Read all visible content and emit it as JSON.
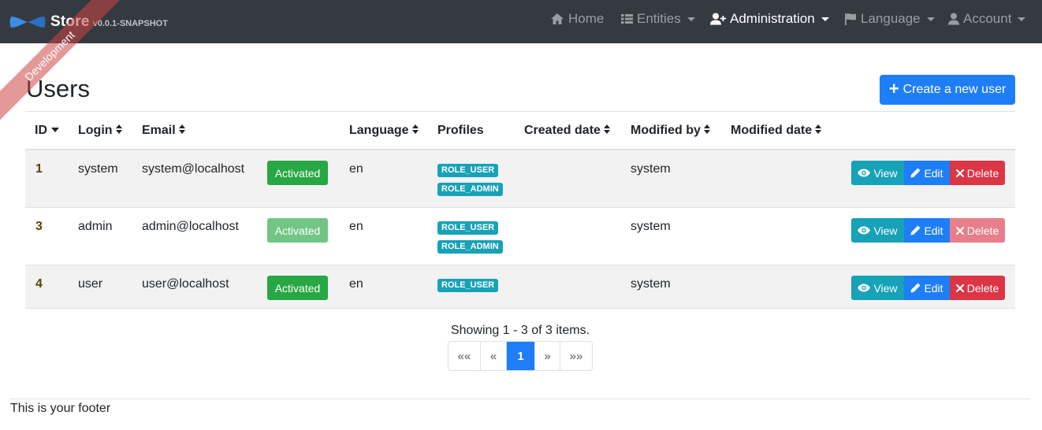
{
  "brand": {
    "title": "Store",
    "version": "v0.0.1-SNAPSHOT"
  },
  "ribbon": "Development",
  "nav": {
    "home": "Home",
    "entities": "Entities",
    "administration": "Administration",
    "language": "Language",
    "account": "Account"
  },
  "page": {
    "title": "Users",
    "create_label": "Create a new user"
  },
  "table": {
    "headers": {
      "id": "ID",
      "login": "Login",
      "email": "Email",
      "language": "Language",
      "profiles": "Profiles",
      "created_date": "Created date",
      "modified_by": "Modified by",
      "modified_date": "Modified date"
    },
    "rows": [
      {
        "id": "1",
        "login": "system",
        "email": "system@localhost",
        "status": "Activated",
        "language": "en",
        "profiles": [
          "ROLE_USER",
          "ROLE_ADMIN"
        ],
        "created_date": "",
        "modified_by": "system",
        "modified_date": ""
      },
      {
        "id": "3",
        "login": "admin",
        "email": "admin@localhost",
        "status": "Activated",
        "language": "en",
        "profiles": [
          "ROLE_USER",
          "ROLE_ADMIN"
        ],
        "created_date": "",
        "modified_by": "system",
        "modified_date": ""
      },
      {
        "id": "4",
        "login": "user",
        "email": "user@localhost",
        "status": "Activated",
        "language": "en",
        "profiles": [
          "ROLE_USER"
        ],
        "created_date": "",
        "modified_by": "system",
        "modified_date": ""
      }
    ],
    "actions": {
      "view": "View",
      "edit": "Edit",
      "delete": "Delete"
    }
  },
  "pagination": {
    "summary": "Showing 1 - 3 of 3 items.",
    "first": "««",
    "prev": "«",
    "current": "1",
    "next": "»",
    "last": "»»"
  },
  "footer": "This is your footer",
  "colors": {
    "navbar": "#343a40",
    "primary": "#1e7ef7",
    "success": "#28a745",
    "info": "#17a2b8",
    "danger": "#dc3545"
  }
}
